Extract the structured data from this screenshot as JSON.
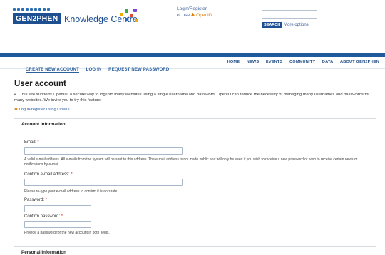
{
  "header": {
    "brand_badge": "GEN2PHEN",
    "brand_text": "Knowledge Centre",
    "login_register": "Login/Register",
    "or_use_openid": "or use",
    "openid_label": "OpenID",
    "search_button": "SEARCH",
    "more_options": "More options"
  },
  "nav": {
    "items": [
      "HOME",
      "NEWS",
      "EVENTS",
      "COMMUNITY",
      "DATA",
      "ABOUT GEN2PHEN"
    ]
  },
  "tabs": {
    "items": [
      "CREATE NEW ACCOUNT",
      "LOG IN",
      "REQUEST NEW PASSWORD"
    ]
  },
  "page": {
    "title": "User account",
    "intro": "This site supports OpenID, a secure way to log into many websites using a single username and password. OpenID can reduce the necessity of managing many usernames and passwords for many websites. We invite you to try this feature.",
    "openid_link": "Log in/register using OpenID"
  },
  "account_info": {
    "legend": "Account information",
    "email_label": "Email:",
    "email_help": "A valid e-mail address. All e-mails from the system will be sent to this address. The e-mail address is not made public and will only be used if you wish to receive a new password or wish to receive certain news or notifications by e-mail.",
    "confirm_email_label": "Confirm e-mail address:",
    "confirm_email_help": "Please re-type your e-mail address to confirm it is accurate.",
    "password_label": "Password:",
    "confirm_password_label": "Confirm password:",
    "password_help": "Provide a password for the new account in both fields.",
    "required_mark": "*"
  },
  "personal_info": {
    "legend": "Personal Information"
  },
  "colors": {
    "brand": "#1d4f91",
    "bar": "#1f5a9d",
    "link": "#2b5f9e",
    "openid": "#e27800",
    "required": "#d21e1e"
  }
}
